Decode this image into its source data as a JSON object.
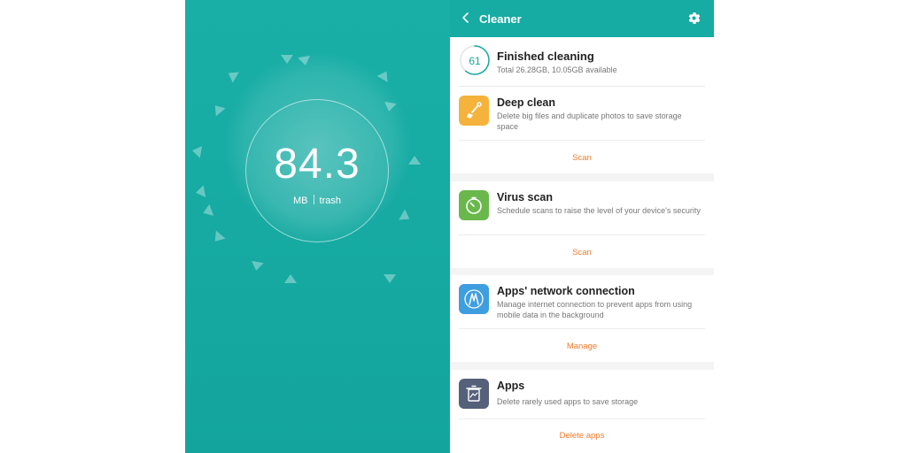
{
  "gauge": {
    "value": "84.3",
    "unit": "MB",
    "label": "trash"
  },
  "header": {
    "title": "Cleaner",
    "back_icon": "chevron-left-icon",
    "settings_icon": "gear-icon"
  },
  "status": {
    "score": "61",
    "score_fraction": 0.61,
    "title": "Finished cleaning",
    "subtitle": "Total 26.28GB, 10.05GB available"
  },
  "cards": [
    {
      "title": "Deep clean",
      "description": "Delete big files and duplicate photos to save storage space",
      "action": "Scan",
      "icon": "broom-icon",
      "icon_color": "#f5b33c"
    },
    {
      "title": "Virus scan",
      "description": "Schedule scans to raise the level of your device's security",
      "action": "Scan",
      "icon": "timer-icon",
      "icon_color": "#6ab84b"
    },
    {
      "title": "Apps' network connection",
      "description": "Manage internet connection to prevent apps from using mobile data in the background",
      "action": "Manage",
      "icon": "network-icon",
      "icon_color": "#3f9ee0"
    },
    {
      "title": "Apps",
      "description": "Delete rarely used apps to save storage",
      "action": "Delete apps",
      "icon": "trash-app-icon",
      "icon_color": "#55607a"
    }
  ],
  "colors": {
    "teal": "#16aba3",
    "action_orange": "#f07b2b"
  }
}
